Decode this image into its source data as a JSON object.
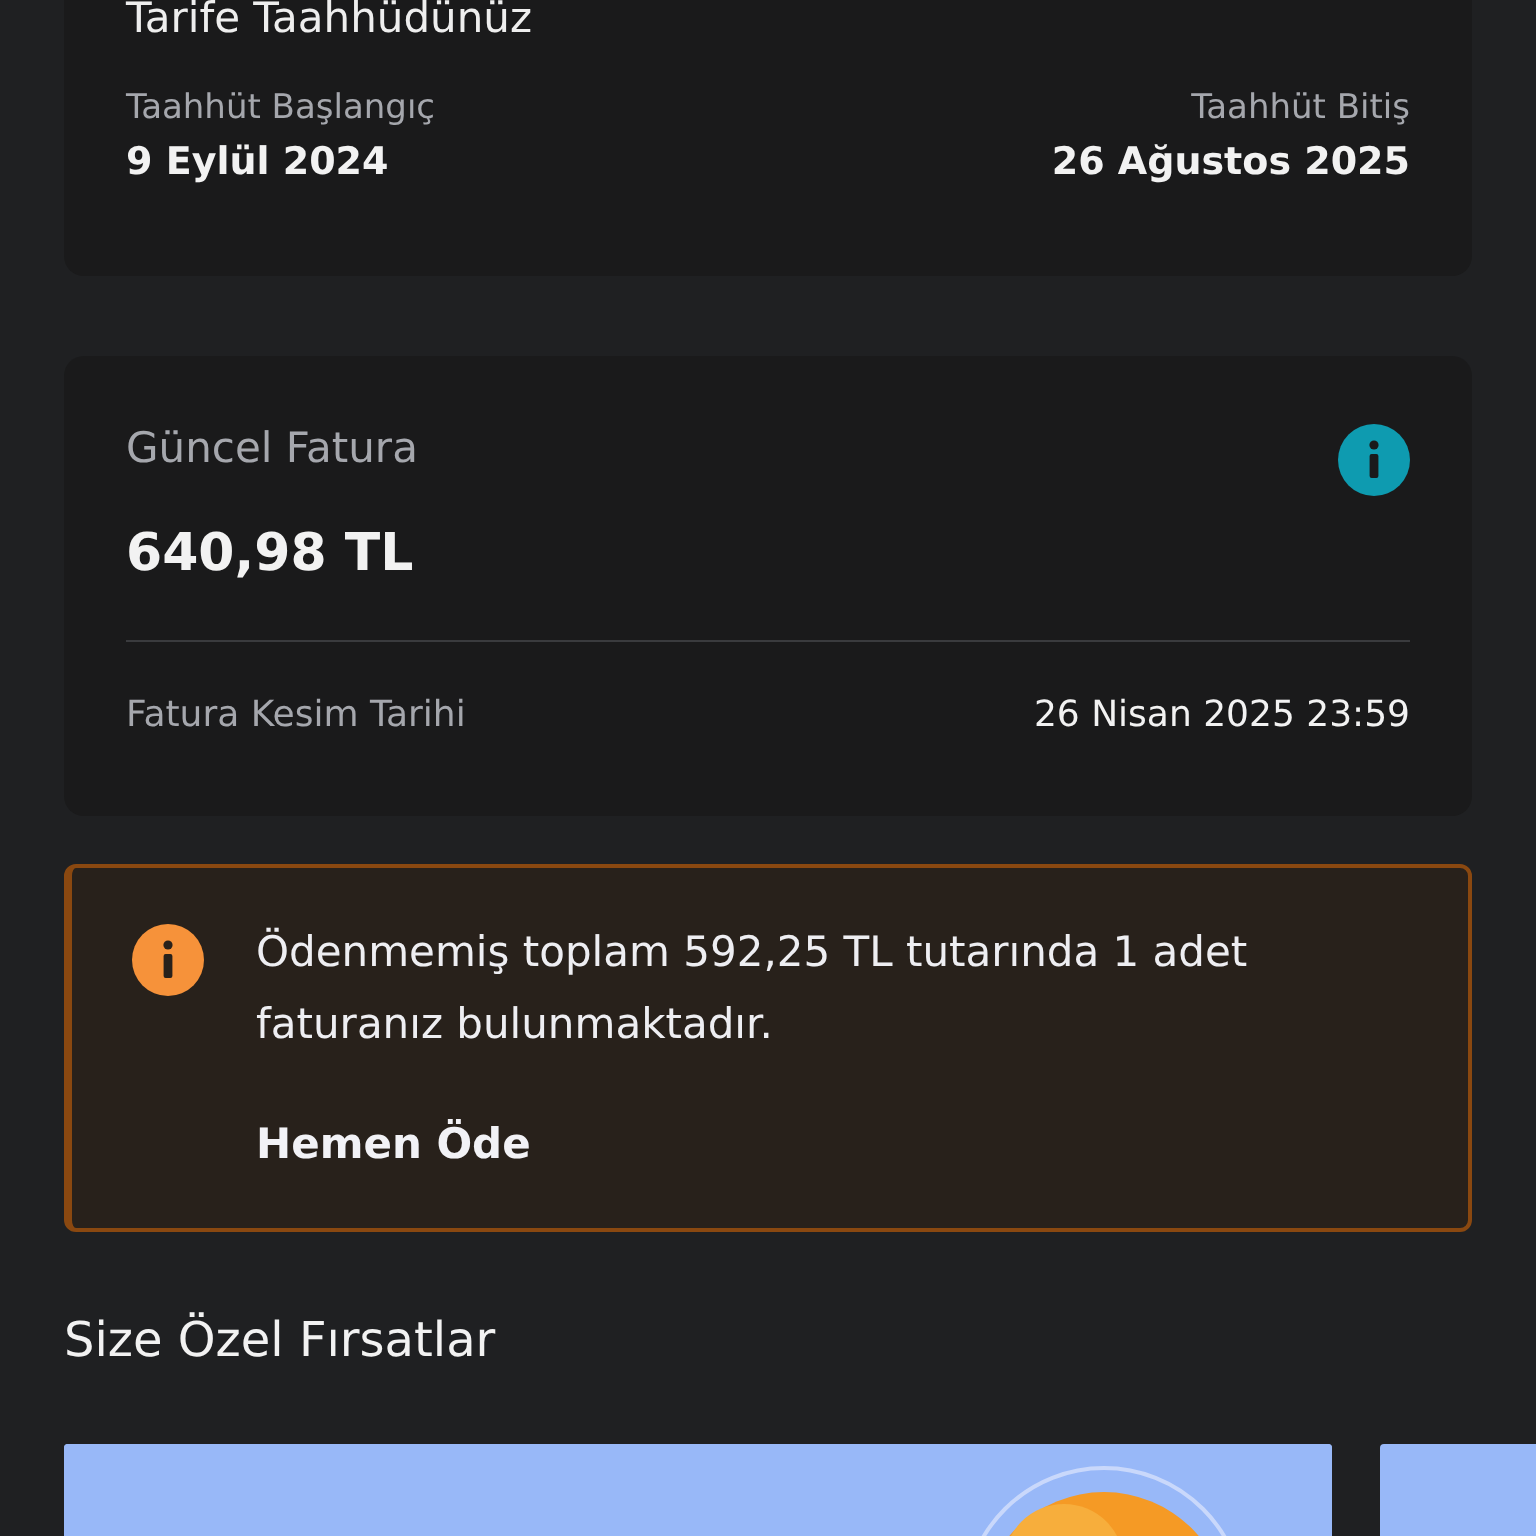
{
  "commitment": {
    "title": "Tarife Taahhüdünüz",
    "start_label": "Taahhüt Başlangıç",
    "start_value": "9 Eylül 2024",
    "end_label": "Taahhüt Bitiş",
    "end_value": "26 Ağustos 2025"
  },
  "invoice": {
    "title": "Güncel Fatura",
    "amount": "640,98 TL",
    "date_label": "Fatura Kesim Tarihi",
    "date_value": "26 Nisan 2025 23:59"
  },
  "alert": {
    "message": "Ödenmemiş toplam 592,25 TL tutarında 1 adet faturanız bulunmaktadır.",
    "action": "Hemen Öde"
  },
  "offers": {
    "title": "Size Özel Fırsatlar",
    "cards": [
      {
        "kind": "picture"
      },
      {
        "kind": "plain"
      }
    ]
  }
}
